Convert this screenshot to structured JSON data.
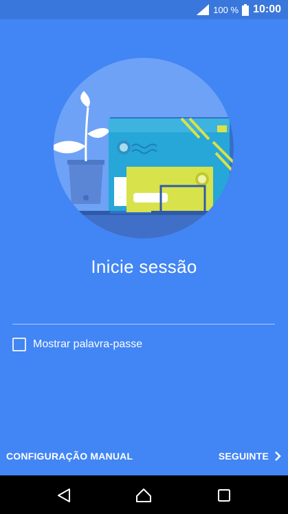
{
  "status_bar": {
    "battery_percent": "100 %",
    "time": "10:00",
    "icons": [
      "signal-icon",
      "battery-icon"
    ]
  },
  "login": {
    "title": "Inicie sessão",
    "password_placeholder": "",
    "show_password_label": "Mostrar palavra-passe",
    "show_password_checked": false
  },
  "footer": {
    "manual_config_label": "CONFIGURAÇÃO MANUAL",
    "next_label": "SEGUINTE"
  },
  "nav_bar": {
    "buttons": [
      "back-icon",
      "home-icon",
      "recents-icon"
    ]
  },
  "colors": {
    "background": "#4285f4",
    "status_bar": "#3a77dc",
    "illustration_circle": "#6ea2f6",
    "envelope_teal": "#27a6d8",
    "envelope_yellow": "#d8e24a",
    "nav_bar": "#000000"
  }
}
